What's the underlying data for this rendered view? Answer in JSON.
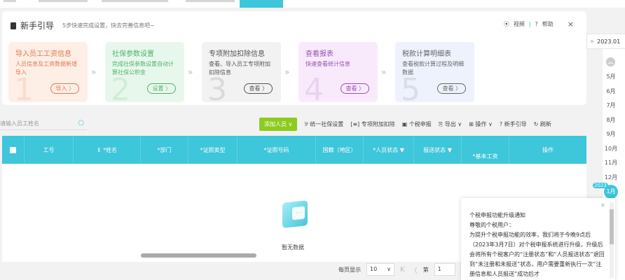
{
  "guide": {
    "title": "新手引导",
    "subtitle": "5步快速完成设置，快去完善信息吧~",
    "video": "视频",
    "help": "帮助",
    "close": "×",
    "cards": [
      {
        "num": "1",
        "title": "导入员工工资信息",
        "desc": "人员信息及工资数据新增导入",
        "button": "导入 〉",
        "color": "#e07b4f",
        "bg": "#fdeee6"
      },
      {
        "num": "2",
        "title": "社保参数设置",
        "desc": "完成社保参数设置自动计算社保公积金",
        "button": "设置 〉",
        "color": "#4db36a",
        "bg": "#e8f7ec"
      },
      {
        "num": "3",
        "title": "专项附加扣除信息",
        "desc": "查看、导入员工专项附加扣除信息",
        "button": "查看 〉",
        "color": "#555555",
        "bg": "#f2f2f2"
      },
      {
        "num": "4",
        "title": "查看报表",
        "desc": "快速查看统计信息",
        "button": "查看 〉",
        "color": "#9b4fb5",
        "bg": "#f8eafb"
      },
      {
        "num": "5",
        "title": "税款计算明细表",
        "desc": "查看税款计算过程及明细数据",
        "button": "查看 〉",
        "color": "#666666",
        "bg": "#eef2fc"
      }
    ]
  },
  "search": {
    "placeholder": "请输入员工姓名"
  },
  "toolbar": {
    "add": "添加人员 ∨",
    "social": "统一社保设置",
    "special": "专项附加扣除",
    "declare": "个税申报",
    "export": "导出 ∨",
    "ops": "操作 ∨",
    "guide": "新手引导",
    "refresh": "刷新"
  },
  "table": {
    "headers": [
      "工号",
      "*姓名",
      "*部门",
      "*证照类型",
      "*证照号码",
      "国籍（地区）",
      "*人员状态",
      "报送状态",
      "*基本工资",
      "操作"
    ],
    "empty": "暂无数据"
  },
  "pager": {
    "per_page_label": "每页显示",
    "per_page": "10",
    "page_label": "第",
    "page": "1"
  },
  "sidebar": {
    "date": "2023.01",
    "months": [
      "5月",
      "6月",
      "7月",
      "8月",
      "9月",
      "10月",
      "11月",
      "12月"
    ],
    "current_year": "2023",
    "current_month": "1月"
  },
  "notice": {
    "lines": [
      "个税申报功能升级通知",
      "尊敬的个税用户：",
      "为提升个税申报功能的效率，我们将于今晚9点后（2023年3月7日）对个税申报系统进行升级，升级后会将所有个税客户的“注册状态”和“人员报送状态”退回到“未注册和未报送”状态，用户需要重新执行一次“注册信息和人员报送”成功后才"
    ]
  },
  "colors": {
    "accent": "#3ec6da",
    "add": "#8ccc1e"
  }
}
